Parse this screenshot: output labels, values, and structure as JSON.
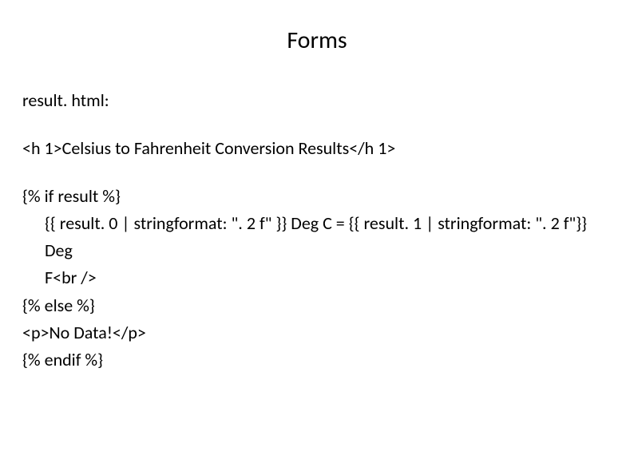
{
  "title": "Forms",
  "label": "result. html:",
  "tagLine": "<h 1>Celsius to Fahrenheit Conversion Results</h 1>",
  "code": {
    "line1": "{% if result %}",
    "line2a": "{{ result. 0 | stringformat: \". 2 f\" }} Deg C = {{ result. 1 | stringformat: \". 2 f\"}} Deg",
    "line2b": "F<br />",
    "line3": "{% else %}",
    "line4": "<p>No Data!</p>",
    "line5": "{% endif %}"
  }
}
